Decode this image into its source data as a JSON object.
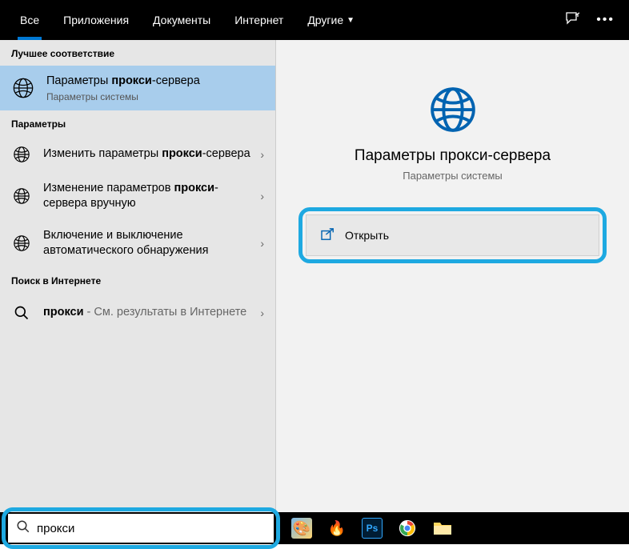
{
  "topbar": {
    "tabs": [
      {
        "label": "Все",
        "active": true
      },
      {
        "label": "Приложения",
        "active": false
      },
      {
        "label": "Документы",
        "active": false
      },
      {
        "label": "Интернет",
        "active": false
      },
      {
        "label": "Другие",
        "dropdown": true,
        "active": false
      }
    ]
  },
  "left": {
    "best_header": "Лучшее соответствие",
    "best_match": {
      "title_pre": "Параметры ",
      "title_bold": "прокси",
      "title_post": "-сервера",
      "subtitle": "Параметры системы"
    },
    "params_header": "Параметры",
    "params": [
      {
        "pre": "Изменить параметры ",
        "bold": "прокси",
        "post": "-сервера"
      },
      {
        "pre": "Изменение параметров ",
        "bold": "прокси",
        "post": "-сервера вручную"
      },
      {
        "pre": "Включение и выключение автоматического обнаружения",
        "bold": "",
        "post": ""
      }
    ],
    "web_header": "Поиск в Интернете",
    "web_item": {
      "bold": "прокси",
      "post": " - См. результаты в Интернете"
    }
  },
  "detail": {
    "title": "Параметры прокси-сервера",
    "subtitle": "Параметры системы",
    "open_label": "Открыть"
  },
  "search": {
    "value": "прокси"
  },
  "colors": {
    "accent": "#0078d4",
    "highlight_border": "#1ea9e1",
    "selected_bg": "#a8cdec"
  }
}
